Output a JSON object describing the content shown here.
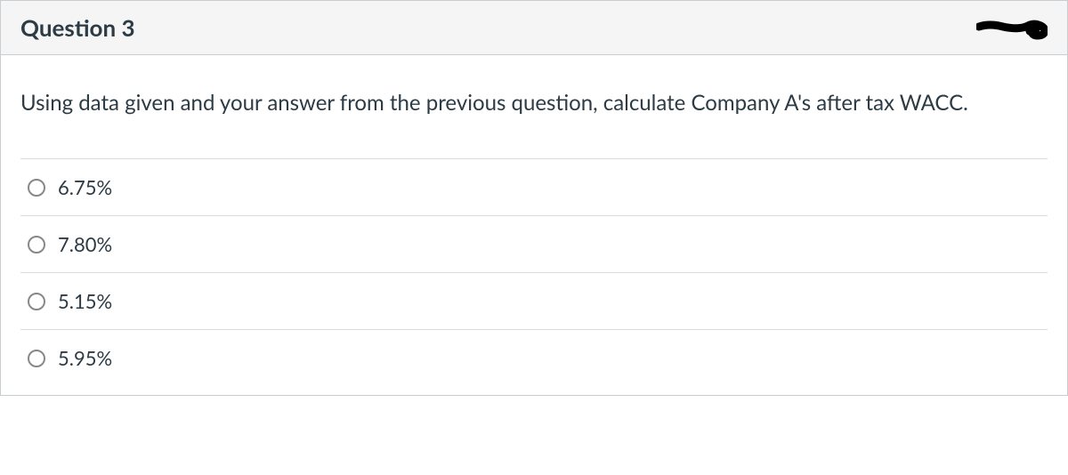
{
  "header": {
    "title": "Question 3"
  },
  "question": {
    "text": "Using data given and your answer from the previous question, calculate Company A's after tax WACC."
  },
  "options": [
    {
      "label": "6.75%"
    },
    {
      "label": "7.80%"
    },
    {
      "label": "5.15%"
    },
    {
      "label": "5.95%"
    }
  ]
}
